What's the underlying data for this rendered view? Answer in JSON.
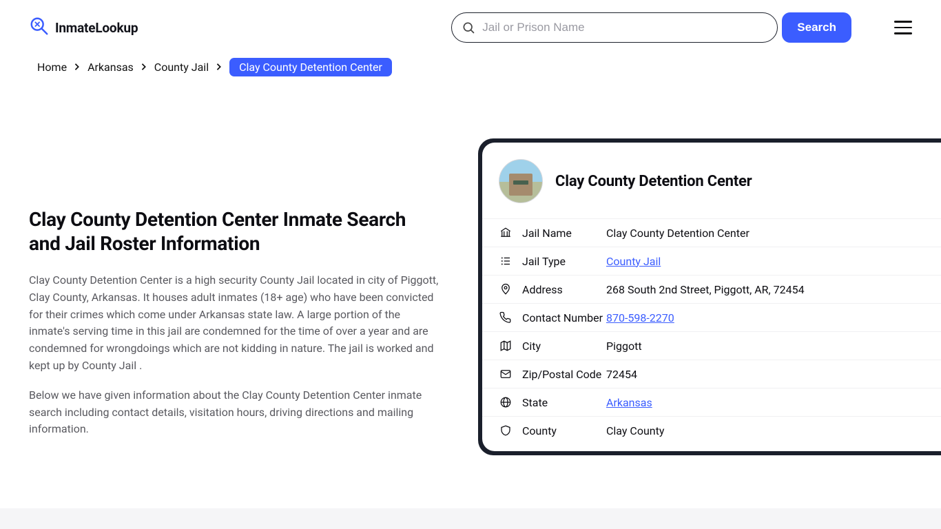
{
  "brand": {
    "name": "InmateLookup"
  },
  "search": {
    "placeholder": "Jail or Prison Name",
    "button": "Search"
  },
  "breadcrumb": {
    "items": [
      "Home",
      "Arkansas",
      "County Jail"
    ],
    "active": "Clay County Detention Center"
  },
  "page": {
    "title": "Clay County Detention Center Inmate Search and Jail Roster Information",
    "para1": "Clay County Detention Center is a high security County Jail located in city of Piggott, Clay County, Arkansas. It houses adult inmates (18+ age) who have been convicted for their crimes which come under Arkansas state law. A large portion of the inmate's serving time in this jail are condemned for the time of over a year and are condemned for wrongdoings which are not kidding in nature. The jail is worked and kept up by County Jail .",
    "para2": "Below we have given information about the Clay County Detention Center inmate search including contact details, visitation hours, driving directions and mailing information."
  },
  "card": {
    "title": "Clay County Detention Center",
    "rows": [
      {
        "icon": "bank",
        "label": "Jail Name",
        "value": "Clay County Detention Center",
        "link": false
      },
      {
        "icon": "list",
        "label": "Jail Type",
        "value": "County Jail",
        "link": true
      },
      {
        "icon": "pin",
        "label": "Address",
        "value": "268 South 2nd Street, Piggott, AR, 72454",
        "link": false
      },
      {
        "icon": "phone",
        "label": "Contact Number",
        "value": "870-598-2270",
        "link": true
      },
      {
        "icon": "mapfold",
        "label": "City",
        "value": "Piggott",
        "link": false
      },
      {
        "icon": "envelope",
        "label": "Zip/Postal Code",
        "value": "72454",
        "link": false
      },
      {
        "icon": "globe",
        "label": "State",
        "value": "Arkansas",
        "link": true
      },
      {
        "icon": "shield",
        "label": "County",
        "value": "Clay County",
        "link": false
      }
    ]
  }
}
